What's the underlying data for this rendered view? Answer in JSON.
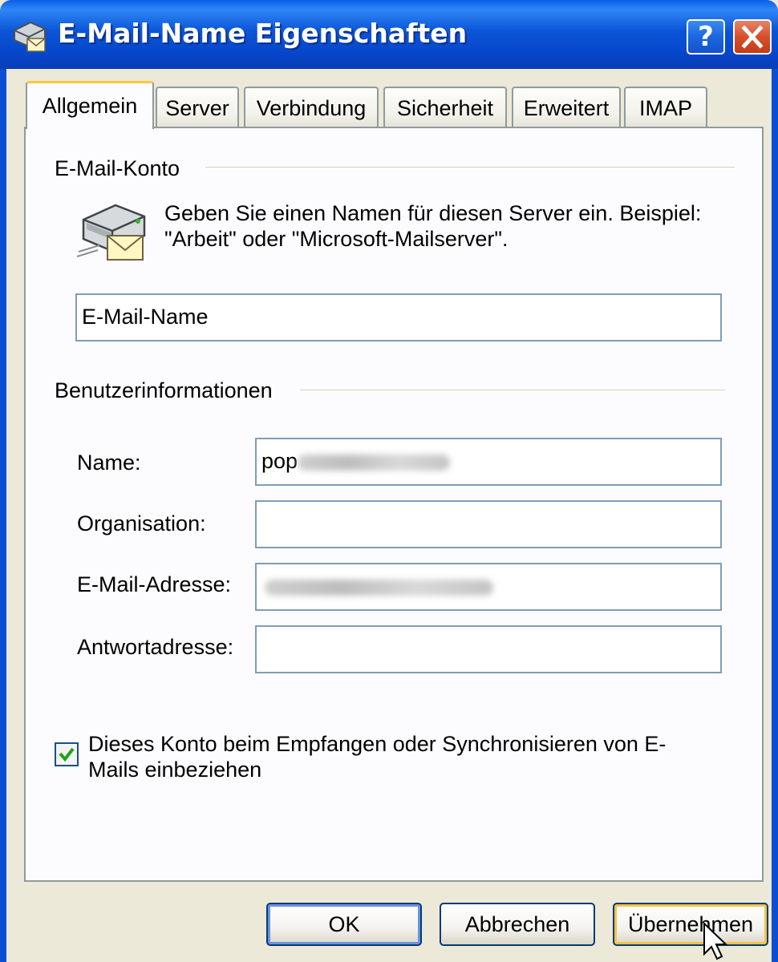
{
  "window": {
    "title": "E-Mail-Name Eigenschaften",
    "help_label": "?",
    "icon": "mail-server-icon"
  },
  "tabs": [
    {
      "label": "Allgemein",
      "active": true
    },
    {
      "label": "Server"
    },
    {
      "label": "Verbindung"
    },
    {
      "label": "Sicherheit"
    },
    {
      "label": "Erweitert"
    },
    {
      "label": "IMAP"
    }
  ],
  "mail_account": {
    "group_label": "E-Mail-Konto",
    "description": "Geben Sie einen Namen für diesen Server ein. Beispiel: \"Arbeit\" oder \"Microsoft-Mailserver\".",
    "name_value": "E-Mail-Name"
  },
  "user_info": {
    "group_label": "Benutzerinformationen",
    "name_label": "Name:",
    "name_value": "pop",
    "organisation_label": "Organisation:",
    "organisation_value": "",
    "email_label": "E-Mail-Adresse:",
    "email_value": "",
    "reply_label": "Antwortadresse:",
    "reply_value": ""
  },
  "include_account": {
    "checked": true,
    "label": "Dieses Konto beim Empfangen oder Synchronisieren von E-Mails einbeziehen"
  },
  "buttons": {
    "ok": "OK",
    "cancel": "Abbrechen",
    "apply": "Übernehmen"
  },
  "colors": {
    "titlebar": "#0a55d6",
    "tab_highlight": "#ffc83c",
    "close_button": "#d5502a",
    "checkmark": "#21a121"
  }
}
